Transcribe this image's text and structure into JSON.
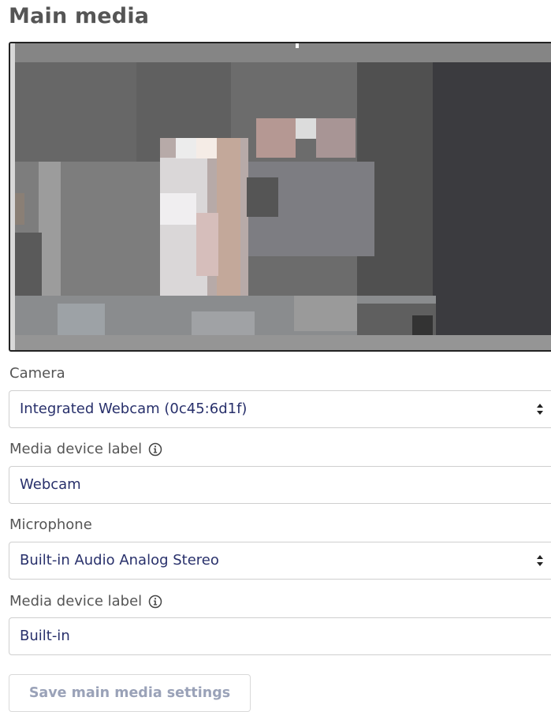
{
  "page": {
    "title": "Main media"
  },
  "camera": {
    "label": "Camera",
    "selected": "Integrated Webcam (0c45:6d1f)",
    "device_label_caption": "Media device label",
    "device_label_value": "Webcam"
  },
  "microphone": {
    "label": "Microphone",
    "selected": "Built-in Audio Analog Stereo",
    "device_label_caption": "Media device label",
    "device_label_value": "Built-in"
  },
  "actions": {
    "save_label": "Save main media settings"
  },
  "icons": {
    "info": "info-circle-icon",
    "select_caret": "updown-caret-icon"
  },
  "colors": {
    "input_text": "#28306b",
    "title": "#555555",
    "disabled_button_text": "#9aa2b8"
  }
}
